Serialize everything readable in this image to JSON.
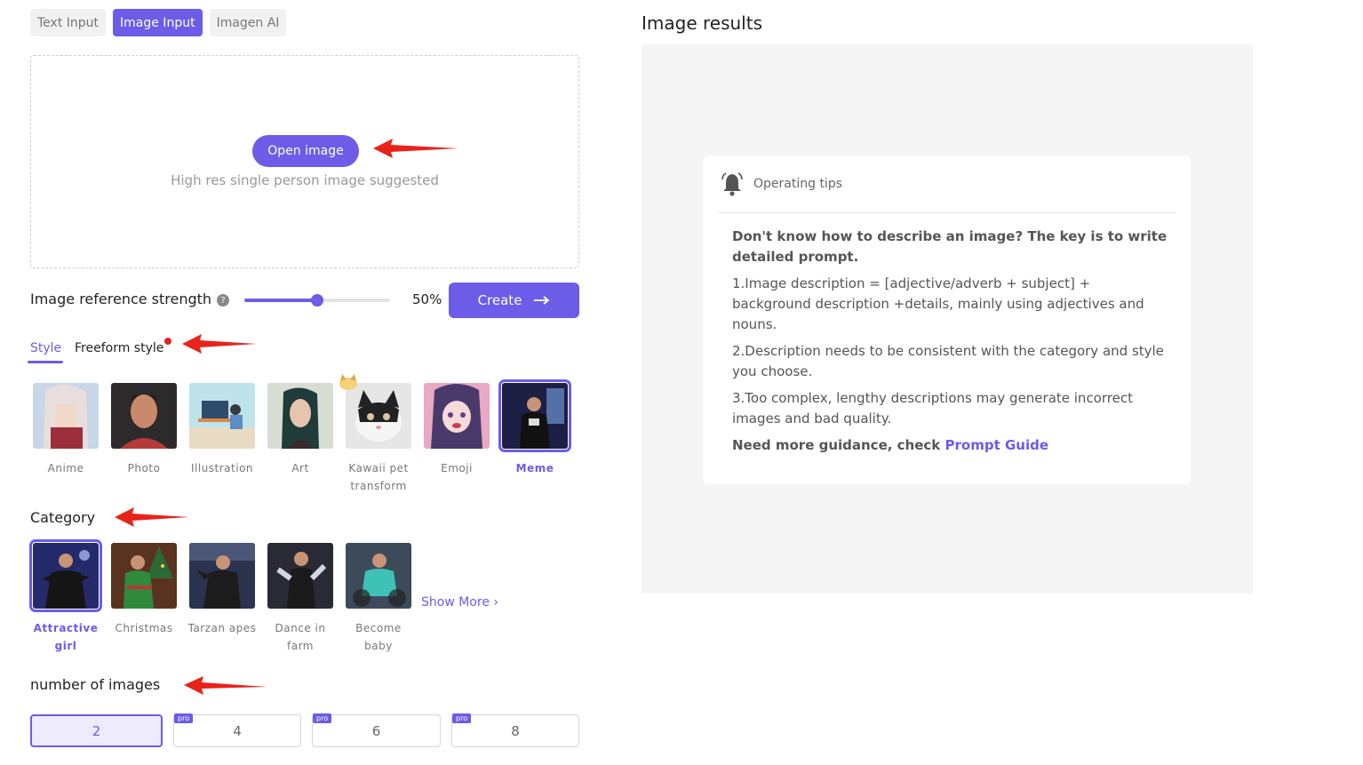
{
  "tabs": [
    {
      "label": "Text Input",
      "active": false
    },
    {
      "label": "Image Input",
      "active": true
    },
    {
      "label": "Imagen AI",
      "active": false
    }
  ],
  "upload": {
    "button": "Open image",
    "hint": "High res single person image suggested"
  },
  "strength": {
    "label": "Image reference strength",
    "value": 0.5,
    "value_text": "50%"
  },
  "create_label": "Create",
  "style_tabs": [
    "Style",
    "Freeform style"
  ],
  "styles": [
    {
      "label": "Anime"
    },
    {
      "label": "Photo"
    },
    {
      "label": "Illustration"
    },
    {
      "label": "Art"
    },
    {
      "label": "Kawaii pet transform"
    },
    {
      "label": "Emoji"
    },
    {
      "label": "Meme",
      "selected": true
    }
  ],
  "category": {
    "title": "Category",
    "items": [
      {
        "label": "Attractive girl",
        "selected": true
      },
      {
        "label": "Christmas"
      },
      {
        "label": "Tarzan apes"
      },
      {
        "label": "Dance in farm"
      },
      {
        "label": "Become baby"
      }
    ],
    "show_more": "Show More"
  },
  "num_images": {
    "title": "number of images",
    "options": [
      {
        "label": "2",
        "pro": false,
        "selected": true
      },
      {
        "label": "4",
        "pro": true
      },
      {
        "label": "6",
        "pro": true
      },
      {
        "label": "8",
        "pro": true
      }
    ],
    "pro_badge": "pro"
  },
  "results": {
    "title": "Image results",
    "tips_title": "Operating tips",
    "tips": {
      "intro": "Don't know how to describe an image? The key is to write detailed prompt.",
      "item1": "1.Image description = [adjective/adverb + subject] + background description +details, mainly using adjectives and nouns.",
      "item2": "2.Description needs to be consistent with the category and style you choose.",
      "item3": "3.Too complex, lengthy descriptions may generate incorrect images and bad quality.",
      "guidance": "Need more guidance, check ",
      "link": "Prompt Guide"
    }
  },
  "colors": {
    "accent": "#6c5ce7",
    "annotation_arrow": "#e8231a"
  }
}
